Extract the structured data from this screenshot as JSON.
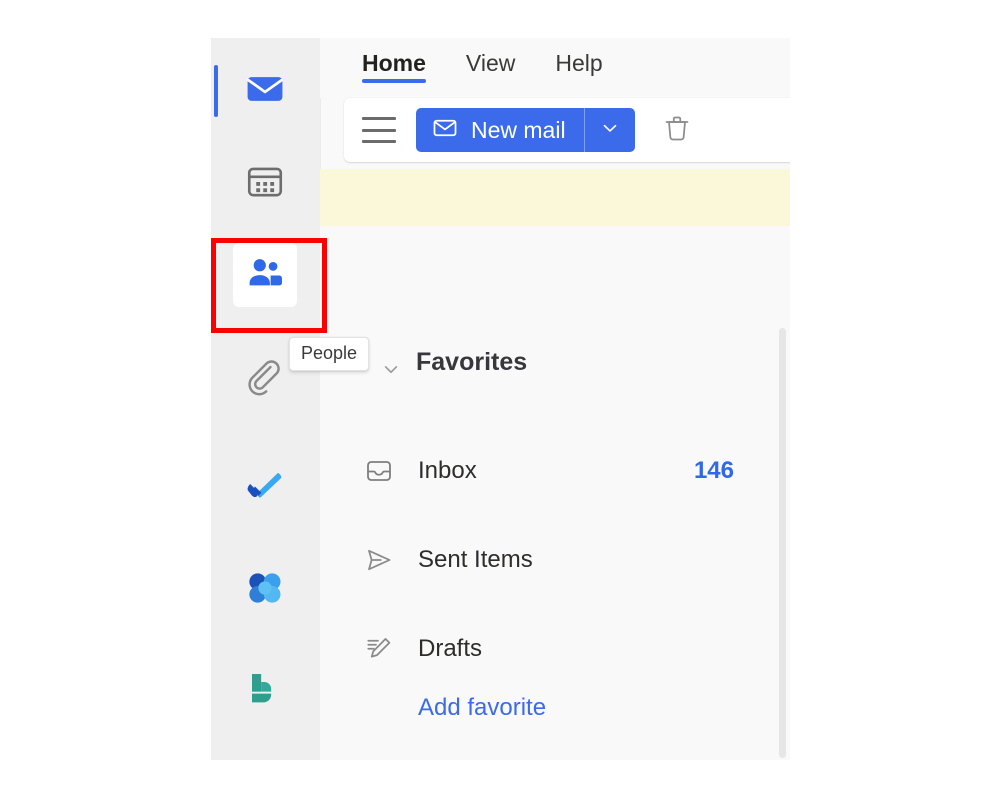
{
  "app_rail": {
    "items": [
      {
        "name": "mail",
        "label": "Mail",
        "icon": "mail-icon",
        "state": "selected"
      },
      {
        "name": "calendar",
        "label": "Calendar",
        "icon": "calendar-icon",
        "state": "normal"
      },
      {
        "name": "people",
        "label": "People",
        "icon": "people-icon",
        "state": "active"
      },
      {
        "name": "files",
        "label": "Files",
        "icon": "paperclip-icon",
        "state": "normal"
      },
      {
        "name": "todo",
        "label": "To Do",
        "icon": "checkmark-icon",
        "state": "normal"
      },
      {
        "name": "loop",
        "label": "Loop",
        "icon": "loop-icon",
        "state": "normal"
      },
      {
        "name": "viva",
        "label": "Viva Engage",
        "icon": "viva-engage-icon",
        "state": "normal"
      }
    ]
  },
  "tooltip": {
    "text": "People"
  },
  "ribbon": {
    "tabs": [
      {
        "label": "Home",
        "active": true
      },
      {
        "label": "View",
        "active": false
      },
      {
        "label": "Help",
        "active": false
      }
    ]
  },
  "toolbar": {
    "menu_icon": "hamburger-icon",
    "new_mail_label": "New mail",
    "new_mail_icon": "envelope-icon",
    "new_mail_caret": "chevron-down-icon",
    "delete_icon": "trash-icon"
  },
  "banner": {
    "text": ""
  },
  "folder_pane": {
    "section_title": "Favorites",
    "section_chevron": "chevron-down-icon",
    "folders": [
      {
        "label": "Inbox",
        "icon": "inbox-icon",
        "count": "146"
      },
      {
        "label": "Sent Items",
        "icon": "send-icon",
        "count": ""
      },
      {
        "label": "Drafts",
        "icon": "draft-icon",
        "count": ""
      }
    ],
    "add_favorite_label": "Add favorite"
  },
  "colors": {
    "accent_blue": "#3b6bea",
    "link_blue": "#3b6bea",
    "count_blue": "#2f68e8",
    "highlight_red": "#fa0202",
    "banner_yellow": "#fbf8da",
    "rail_bg": "#efefef",
    "pane_bg": "#f9f9f9",
    "teal": "#2e9e8f"
  }
}
